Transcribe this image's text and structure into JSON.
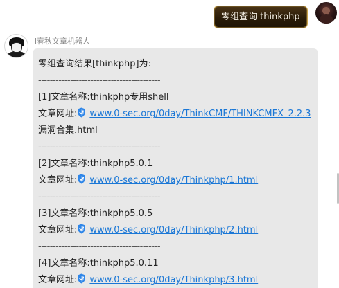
{
  "outgoing": {
    "text": "零组查询 thinkphp"
  },
  "bot": {
    "name": "i春秋文章机器人",
    "header": "零组查询结果[thinkphp]为:",
    "divider": "------------------------------------------",
    "url_label": "文章网址:",
    "results": [
      {
        "title": "[1]文章名称:thinkphp专用shell",
        "url": "www.0-sec.org/0day/ThinkCMF/THINKCMFX_2.2.3",
        "url_cont": "漏洞合集.html"
      },
      {
        "title": "[2]文章名称:thinkphp5.0.1",
        "url": "www.0-sec.org/0day/Thinkphp/1.html"
      },
      {
        "title": "[3]文章名称:thinkphp5.0.5",
        "url": "www.0-sec.org/0day/Thinkphp/2.html"
      },
      {
        "title": "[4]文章名称:thinkphp5.0.11",
        "url": "www.0-sec.org/0day/Thinkphp/3.html"
      }
    ]
  },
  "colors": {
    "link": "#1a77d6",
    "bubble_bg": "#e8e8e8",
    "outgoing_border": "#c8a24a",
    "shield": "#2f86e8"
  },
  "icons": {
    "shield": "shield-icon"
  }
}
